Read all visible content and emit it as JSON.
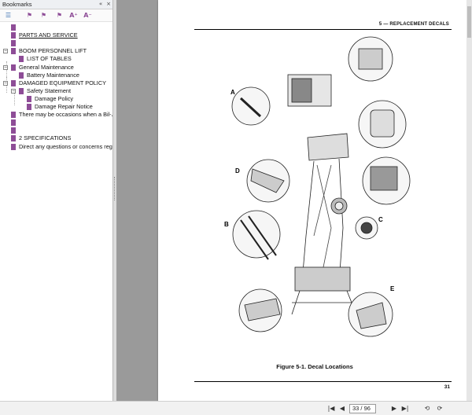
{
  "panel": {
    "title": "Bookmarks",
    "header_buttons": [
      "«",
      "×"
    ]
  },
  "toolbar": {
    "icons": [
      "bookmark-options-icon",
      "new-bookmark-icon",
      "expand-bookmark-icon",
      "delete-bookmark-icon",
      "increase-text-icon",
      "decrease-text-icon"
    ],
    "labels": [
      "☰",
      "⚑",
      "⚑",
      "⚑",
      "A⁺",
      "A⁻"
    ]
  },
  "bookmarks": [
    {
      "label": "",
      "level": 0,
      "expander": ""
    },
    {
      "label": "PARTS AND SERVICE",
      "level": 0,
      "expander": "",
      "underline": true
    },
    {
      "label": "",
      "level": 0,
      "expander": ""
    },
    {
      "label": "BOOM PERSONNEL LIFT",
      "level": 0,
      "expander": "−"
    },
    {
      "label": "LIST OF TABLES",
      "level": 1,
      "expander": ""
    },
    {
      "label": "General Maintenance",
      "level": 0,
      "expander": "−"
    },
    {
      "label": "Battery Maintenance",
      "level": 1,
      "expander": ""
    },
    {
      "label": "DAMAGED EQUIPMENT POLICY",
      "level": 0,
      "expander": "−"
    },
    {
      "label": "Safety Statement",
      "level": 1,
      "expander": "−"
    },
    {
      "label": "Damage Policy",
      "level": 2,
      "expander": ""
    },
    {
      "label": "Damage Repair Notice",
      "level": 2,
      "expander": ""
    },
    {
      "label": "There may be occasions when a Bil-Ja",
      "level": 0,
      "expander": ""
    },
    {
      "label": "",
      "level": 0,
      "expander": ""
    },
    {
      "label": "",
      "level": 0,
      "expander": ""
    },
    {
      "label": "2 SPECIFICATIONS",
      "level": 0,
      "expander": ""
    },
    {
      "label": "Direct any questions or concerns rega",
      "level": 0,
      "expander": ""
    }
  ],
  "document": {
    "running_head": "5 — REPLACEMENT DECALS",
    "caption": "Figure 5-1.  Decal Locations",
    "page_number": "31"
  },
  "figure_callouts": [
    "A",
    "B",
    "C",
    "D",
    "E"
  ],
  "statusbar": {
    "page_field": "33 / 96",
    "nav": [
      "|◀",
      "◀",
      "▶",
      "▶|",
      "⟲",
      "⟳"
    ]
  }
}
